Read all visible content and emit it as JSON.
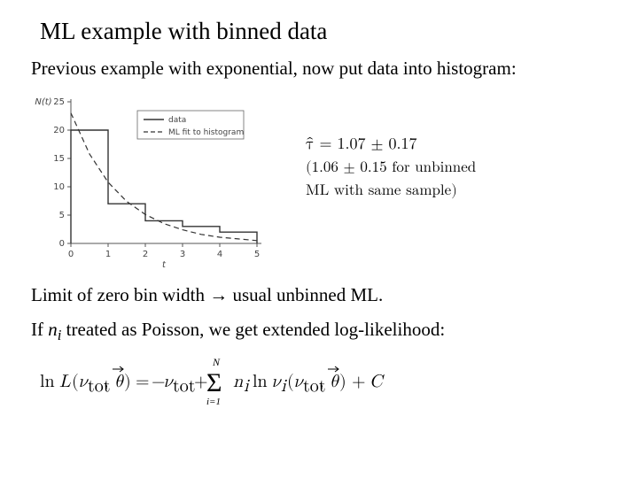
{
  "title": "ML example with binned data",
  "subtitle": "Previous example with exponential, now put data into histogram:",
  "estimate": {
    "main": "τ̂ = 1.07 ± 0.17",
    "sub1": "(1.06 ± 0.15 for unbinned",
    "sub2": "ML with same sample)"
  },
  "limit_line": "Limit of zero bin width → usual unbinned ML.",
  "poisson_prefix": "If ",
  "poisson_var": "n",
  "poisson_sub": "i",
  "poisson_suffix": " treated as Poisson, we get extended log-likelihood:",
  "formula": "ln L(ν_tot, θ⃗) = −ν_tot + Σ_{i=1}^{N} n_i ln ν_i(ν_tot, θ⃗) + C",
  "chart_data": {
    "type": "bar",
    "title": "",
    "xlabel": "t",
    "ylabel": "N(t)",
    "xlim": [
      0,
      5
    ],
    "ylim": [
      0,
      25
    ],
    "xticks": [
      0,
      1,
      2,
      3,
      4,
      5
    ],
    "yticks": [
      0,
      5,
      10,
      15,
      20,
      25
    ],
    "categories": [
      0.5,
      1.5,
      2.5,
      3.5,
      4.5
    ],
    "series": [
      {
        "name": "data",
        "type": "step",
        "values": [
          20,
          7,
          4,
          3,
          2
        ]
      },
      {
        "name": "ML fit to histogram",
        "type": "line-dashed",
        "x": [
          0,
          0.5,
          1,
          1.5,
          2,
          2.5,
          3,
          3.5,
          4,
          4.5,
          5
        ],
        "y": [
          23,
          15.8,
          10.8,
          7.4,
          5.1,
          3.5,
          2.4,
          1.6,
          1.1,
          0.8,
          0.5
        ]
      }
    ],
    "legend": [
      "data",
      "ML fit to histogram"
    ]
  }
}
